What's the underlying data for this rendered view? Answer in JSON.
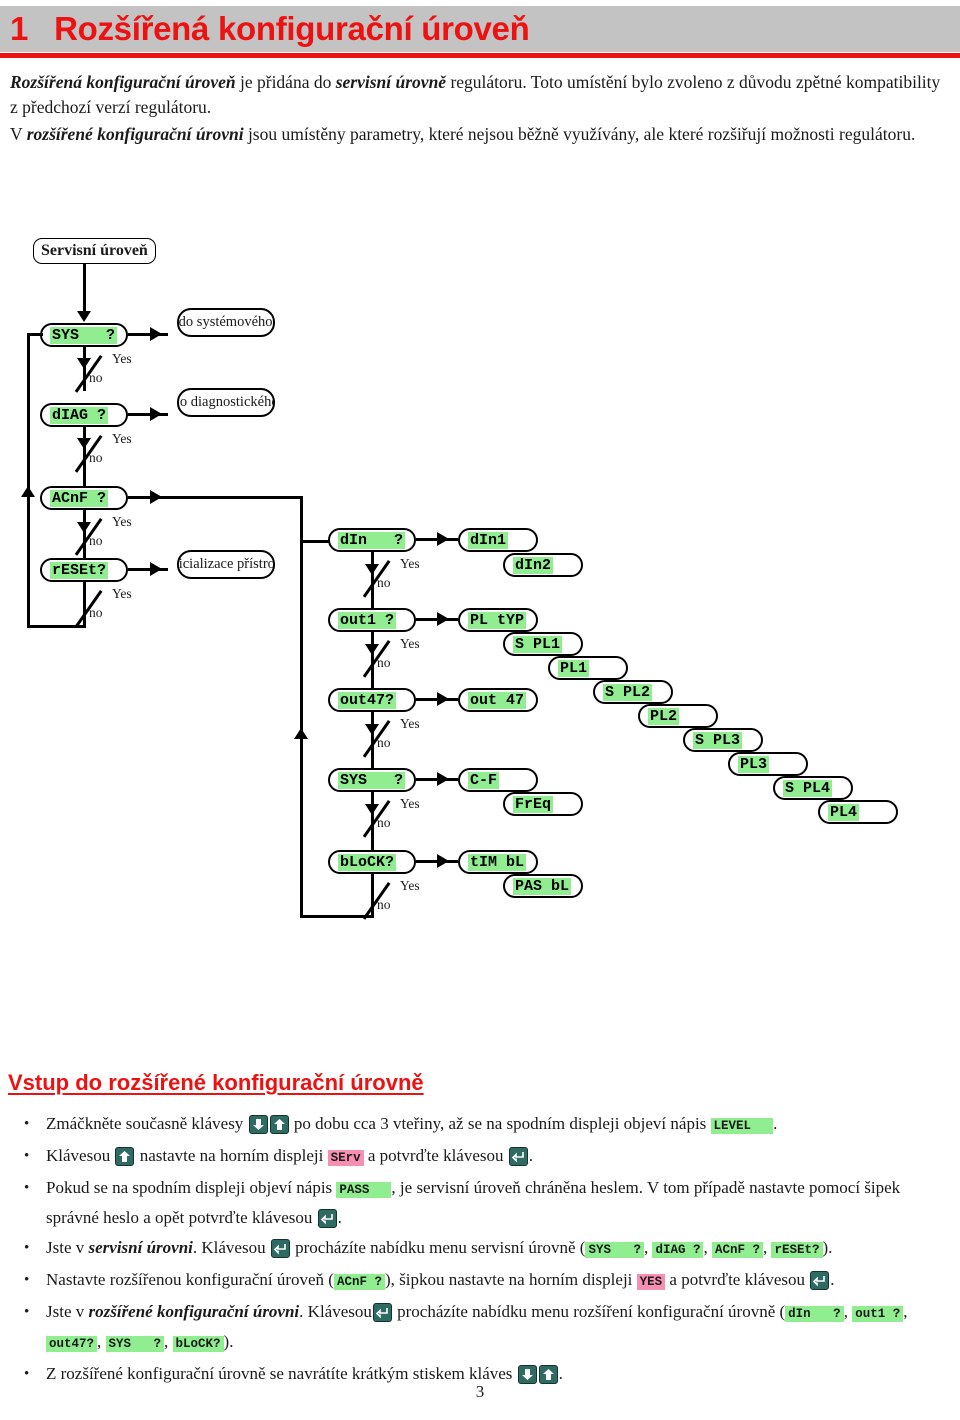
{
  "header": {
    "number": "1",
    "title": "Rozšířená konfigurační úroveň",
    "banner_bg": "#c3c3c3",
    "accent": "#ee1111"
  },
  "intro": {
    "para1_lead": "Rozšířená konfigurační úroveň",
    "para1_mid": " je přidána do ",
    "para1_em2": "servisní úrovně",
    "para1_tail": " regulátoru. Toto umístění bylo zvoleno z důvodu zpětné kompatibility z předchozí verzí regulátoru.",
    "para2_lead": "V ",
    "para2_em": "rozšířené konfigurační úrovni",
    "para2_tail": " jsou umístěny parametry, které nejsou běžně využívány, ale které rozšiřují možnosti regulátoru."
  },
  "diagram": {
    "start_label": "Servisní úroveň",
    "branch_yes": "Yes",
    "branch_no": "no",
    "highlight_color": "#90ee90",
    "left_column": [
      {
        "code": "SYS   ?",
        "target": "vstup do systémového menu"
      },
      {
        "code": "dIAG ?",
        "target": "vstup do diagnostického menu"
      },
      {
        "code": "ACnF ?",
        "target": ""
      },
      {
        "code": "rESEt?",
        "target": "Inicializace přístroje"
      }
    ],
    "targets_prose": {
      "sys": "vstup do systémového menu",
      "diag": "vstup do diagnostického menu",
      "reset": "Inicializace přístroje"
    },
    "right_column": [
      {
        "code": "dIn   ?",
        "result": "dIn1"
      },
      {
        "code": "out1 ?",
        "result": "PL tYP"
      },
      {
        "code": "out47?",
        "result": "out 47"
      },
      {
        "code": "SYS   ?",
        "result": "C-F"
      },
      {
        "code": "bLoCK?",
        "result": "tIM bL"
      }
    ],
    "sub_results": {
      "din2": "dIn2",
      "freq": "FrEq",
      "pasbl": "PAS bL"
    },
    "pl_cascade": [
      "S PL1",
      "PL1",
      "S PL2",
      "PL2",
      "S PL3",
      "PL3",
      "S PL4",
      "PL4"
    ]
  },
  "section": {
    "heading": "Vstup do rozšířené konfigurační úrovně"
  },
  "bullets": {
    "b1_a": "Zmáčkněte současně klávesy",
    "b1_b": "po dobu cca 3 vteřiny, až se na spodním displeji objeví nápis",
    "b1_code": "LEVEL",
    "b1_c": ".",
    "b2_a": "Klávesou",
    "b2_b": "nastavte na horním displeji",
    "b2_code": "SErv",
    "b2_c": "a potvrďte klávesou",
    "b2_d": ".",
    "b3_a": "Pokud se na spodním displeji objeví nápis",
    "b3_code": "PASS",
    "b3_b": ", je servisní úroveň chráněna heslem. V tom případě nastavte pomocí šipek správné heslo a opět potvrďte klávesou",
    "b3_c": ".",
    "b4_a": "Jste v",
    "b4_em": "servisní úrovni",
    "b4_b": ". Klávesou",
    "b4_c": "procházíte nabídku menu servisní úrovně (",
    "b4_codes": [
      "SYS   ?",
      "dIAG ?",
      "ACnF ?",
      "rESEt?"
    ],
    "b4_d": ").",
    "b5_a": "Nastavte rozšířenou konfigurační úroveň (",
    "b5_code": "ACnF ?",
    "b5_b": "), šipkou nastavte na horním displeji",
    "b5_code2": "YES",
    "b5_c": "a potvrďte klávesou",
    "b5_d": ".",
    "b6_a": "Jste v",
    "b6_em": "rozšířené konfigurační úrovni",
    "b6_b": ". Klávesou",
    "b6_c": "procházíte nabídku menu rozšíření konfigurační úrovně (",
    "b6_codes": [
      "dIn   ?",
      "out1 ?",
      "out47?",
      "SYS   ?",
      "bLoCK?"
    ],
    "b6_d": ").",
    "b7_a": "Z rozšířené konfigurační úrovně se navrátíte krátkým stiskem kláves",
    "b7_b": "."
  },
  "footer": {
    "page": "3"
  }
}
